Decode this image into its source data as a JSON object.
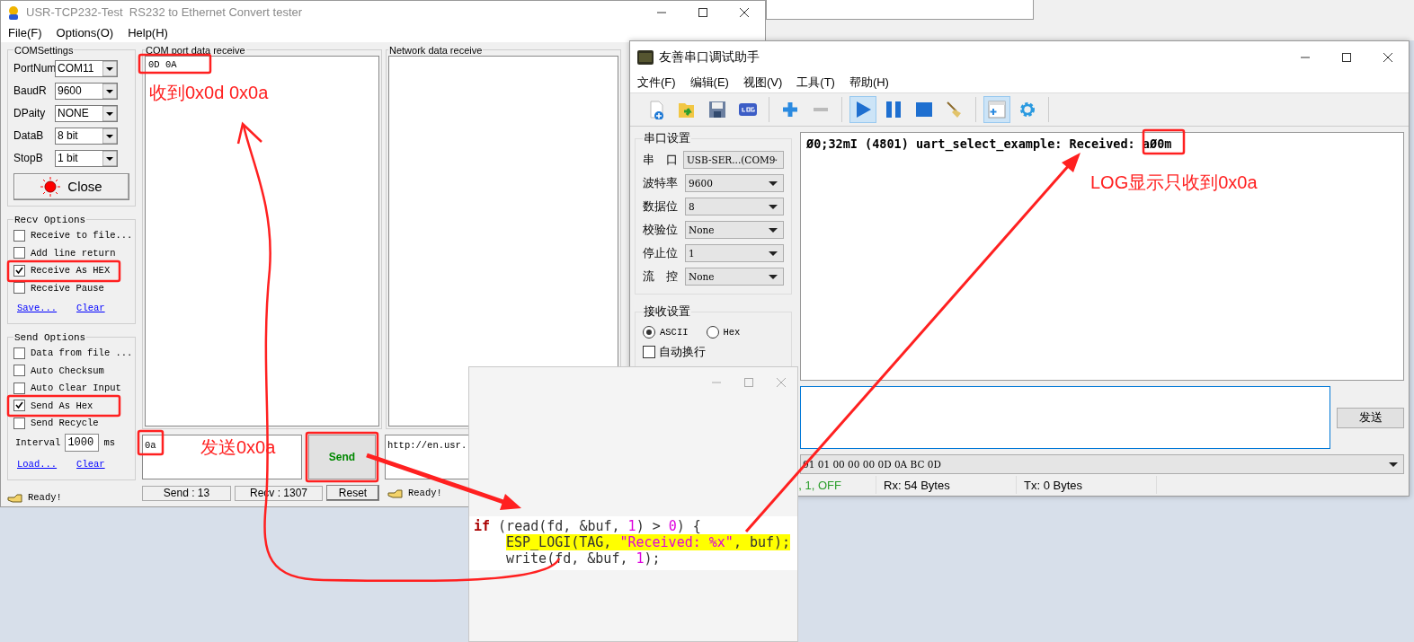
{
  "usr_window": {
    "title": "USR-TCP232-Test  RS232 to Ethernet Convert tester",
    "menu": [
      "File(F)",
      "Options(O)",
      "Help(H)"
    ],
    "com_settings": {
      "title": "COMSettings",
      "fields": [
        {
          "label": "PortNum",
          "value": "COM11"
        },
        {
          "label": "BaudR",
          "value": "9600"
        },
        {
          "label": "DPaity",
          "value": "NONE"
        },
        {
          "label": "DataB",
          "value": "8 bit"
        },
        {
          "label": "StopB",
          "value": "1 bit"
        }
      ],
      "button": "Close"
    },
    "recv_options": {
      "title": "Recv Options",
      "options": [
        {
          "label": "Receive to file...",
          "checked": false
        },
        {
          "label": "Add line return",
          "checked": false
        },
        {
          "label": "Receive As HEX",
          "checked": true
        },
        {
          "label": "Receive Pause",
          "checked": false
        }
      ],
      "links": [
        "Save...",
        "Clear"
      ]
    },
    "send_options": {
      "title": "Send Options",
      "options": [
        {
          "label": "Data from file ...",
          "checked": false
        },
        {
          "label": "Auto Checksum",
          "checked": false
        },
        {
          "label": "Auto Clear Input",
          "checked": false
        },
        {
          "label": "Send As Hex",
          "checked": true
        },
        {
          "label": "Send Recycle",
          "checked": false
        }
      ],
      "interval": {
        "label": "Interval",
        "value": "1000",
        "unit": "ms"
      },
      "links": [
        "Load...",
        "Clear"
      ]
    },
    "com_receive": {
      "title": "COM port data receive",
      "text": "0D 0A"
    },
    "network_receive": {
      "title": "Network data receive"
    },
    "send_input": {
      "value": "0a"
    },
    "send_button": "Send",
    "url_field": {
      "value": "http://en.usr."
    },
    "status": {
      "left": "Ready!",
      "send": "Send : 13",
      "recv": "Recv : 1307",
      "reset": "Reset",
      "right": "Ready!"
    }
  },
  "serial_assistant": {
    "title": "友善串口调试助手",
    "menu": [
      "文件(F)",
      "编辑(E)",
      "视图(V)",
      "工具(T)",
      "帮助(H)"
    ],
    "toolbar": [
      {
        "pressed": false
      },
      {
        "pressed": false
      },
      {
        "pressed": false
      },
      {
        "pressed": false
      },
      {
        "pressed": false
      },
      {
        "pressed": false
      },
      {
        "pressed": true
      },
      {
        "pressed": false
      },
      {
        "pressed": false
      },
      {
        "pressed": false
      },
      {
        "pressed": true
      },
      {
        "pressed": false
      }
    ],
    "port_settings": {
      "title": "串口设置",
      "fields": [
        {
          "label": "串　口",
          "value": "USB-SER...(COM9"
        },
        {
          "label": "波特率",
          "value": "9600"
        },
        {
          "label": "数据位",
          "value": "8"
        },
        {
          "label": "校验位",
          "value": "None"
        },
        {
          "label": "停止位",
          "value": "1"
        },
        {
          "label": "流　控",
          "value": "None"
        }
      ]
    },
    "receive_settings": {
      "title": "接收设置",
      "modes": [
        {
          "label": "ASCII",
          "selected": true
        },
        {
          "label": "Hex",
          "selected": false
        }
      ],
      "options": [
        {
          "label": "自动换行",
          "checked": false
        }
      ]
    },
    "log": "Ø0;32mI (4801) uart_select_example: Received: aØ0m",
    "send_button": "发送",
    "history": "01 01 00 00 00 0D 0A BC 0D",
    "status": [
      {
        "kind": "port",
        "text": ", 1, OFF"
      },
      {
        "kind": "count",
        "text": "Rx: 54 Bytes"
      },
      {
        "kind": "count",
        "text": "Tx: 0 Bytes"
      }
    ]
  },
  "code_popup": {
    "lines": [
      {
        "highlighted": false,
        "indent": false,
        "tokens": [
          {
            "kind": "keyword",
            "text": "if"
          },
          {
            "kind": "plain",
            "text": " (read(fd, &buf, "
          },
          {
            "kind": "number",
            "text": "1"
          },
          {
            "kind": "plain",
            "text": ") > "
          },
          {
            "kind": "number",
            "text": "0"
          },
          {
            "kind": "plain",
            "text": ") {"
          }
        ]
      },
      {
        "highlighted": true,
        "indent": true,
        "tokens": [
          {
            "kind": "plain",
            "text": "ESP_LOGI(TAG, "
          },
          {
            "kind": "string",
            "text": "\"Received: %x\""
          },
          {
            "kind": "plain",
            "text": ", buf);"
          }
        ]
      },
      {
        "highlighted": false,
        "indent": true,
        "tokens": [
          {
            "kind": "plain",
            "text": "write(fd, &buf, "
          },
          {
            "kind": "number",
            "text": "1"
          },
          {
            "kind": "plain",
            "text": ");"
          }
        ]
      }
    ]
  },
  "annotations": [
    {
      "text": "收到0x0d 0x0a"
    },
    {
      "text": "发送0x0a"
    },
    {
      "text": "LOG显示只收到0x0a"
    }
  ]
}
